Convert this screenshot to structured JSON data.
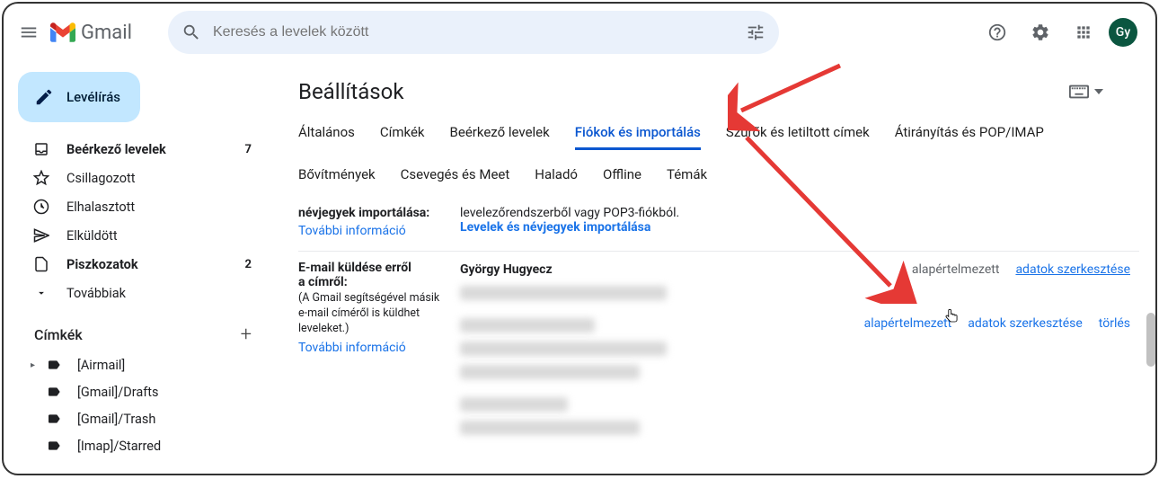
{
  "header": {
    "app_name": "Gmail",
    "search": {
      "placeholder": "Keresés a levelek között"
    },
    "avatar_initials": "Gy"
  },
  "compose": {
    "label": "Levélírás"
  },
  "nav": {
    "items": [
      {
        "icon": "inbox",
        "label": "Beérkező levelek",
        "count": "7",
        "bold": true
      },
      {
        "icon": "star",
        "label": "Csillagozott",
        "count": "",
        "bold": false
      },
      {
        "icon": "clock",
        "label": "Elhalasztott",
        "count": "",
        "bold": false
      },
      {
        "icon": "send",
        "label": "Elküldött",
        "count": "",
        "bold": false
      },
      {
        "icon": "file",
        "label": "Piszkozatok",
        "count": "2",
        "bold": true
      },
      {
        "icon": "chev-down",
        "label": "Továbbiak",
        "count": "",
        "bold": false
      }
    ]
  },
  "labels": {
    "heading": "Címkék",
    "items": [
      {
        "name": "[Airmail]",
        "expandable": true
      },
      {
        "name": "[Gmail]/Drafts",
        "expandable": false
      },
      {
        "name": "[Gmail]/Trash",
        "expandable": false
      },
      {
        "name": "[Imap]/Starred",
        "expandable": false
      }
    ]
  },
  "main": {
    "title": "Beállítások",
    "tabs": [
      "Általános",
      "Címkék",
      "Beérkező levelek",
      "Fiókok és importálás",
      "Szűrők és letiltott címek",
      "Átirányítás és POP/IMAP",
      "Bővítmények",
      "Csevegés és Meet",
      "Haladó",
      "Offline",
      "Témák"
    ],
    "active_tab_index": 3
  },
  "section_import": {
    "head": "névjegyek importálása:",
    "more_info": "További információ",
    "desc": "levelezőrendszerből vagy POP3-fiókból.",
    "action": "Levelek és névjegyek importálása"
  },
  "section_sendas": {
    "head1": "E-mail küldése erről",
    "head2": "a címről:",
    "sub": "(A Gmail segítségével másik e-mail címéről is küldhet leveleket.)",
    "more_info": "További információ",
    "accounts": [
      {
        "name": "György Hugyecz",
        "default_label": "alapértelmezett",
        "is_default": true,
        "edit": "adatok szerkesztése"
      },
      {
        "name": "",
        "default_label": "alapértelmezett",
        "is_default": false,
        "edit": "adatok szerkesztése",
        "delete": "törlés"
      }
    ]
  }
}
